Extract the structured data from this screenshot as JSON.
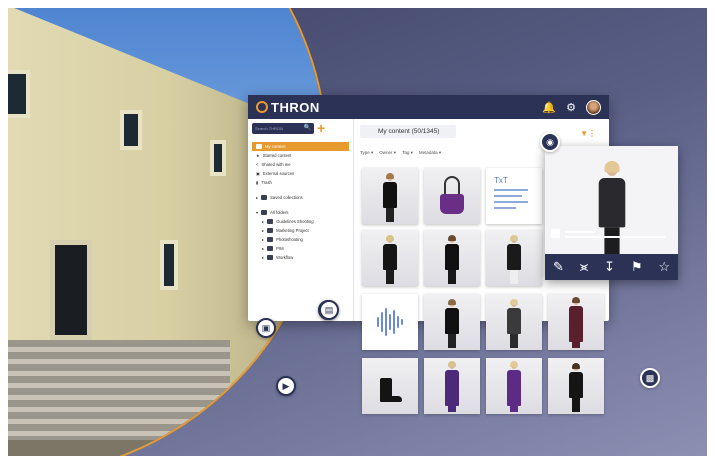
{
  "app": {
    "brand": "THRON",
    "search_placeholder": "Search THRON"
  },
  "sidebar": {
    "items": [
      {
        "label": "My content",
        "icon": "folder-icon"
      },
      {
        "label": "Starred content",
        "icon": "star-icon"
      },
      {
        "label": "Shared with me",
        "icon": "share-icon"
      },
      {
        "label": "External sources",
        "icon": "external-icon"
      },
      {
        "label": "Trash",
        "icon": "trash-icon"
      }
    ],
    "collections_label": "Saved collections",
    "all_folders_label": "All folders",
    "folders": [
      "Guidelines Shooting",
      "Marketing Project",
      "Photoshooting",
      "PIM",
      "Workflow"
    ]
  },
  "content": {
    "title": "My content (50/1345)",
    "filters": [
      "Type",
      "Owner",
      "Tag",
      "Metadata"
    ]
  },
  "thumbs": {
    "text_label": "TxT"
  },
  "colors": {
    "brand_navy": "#2b3256",
    "accent_orange": "#e79a2d"
  }
}
